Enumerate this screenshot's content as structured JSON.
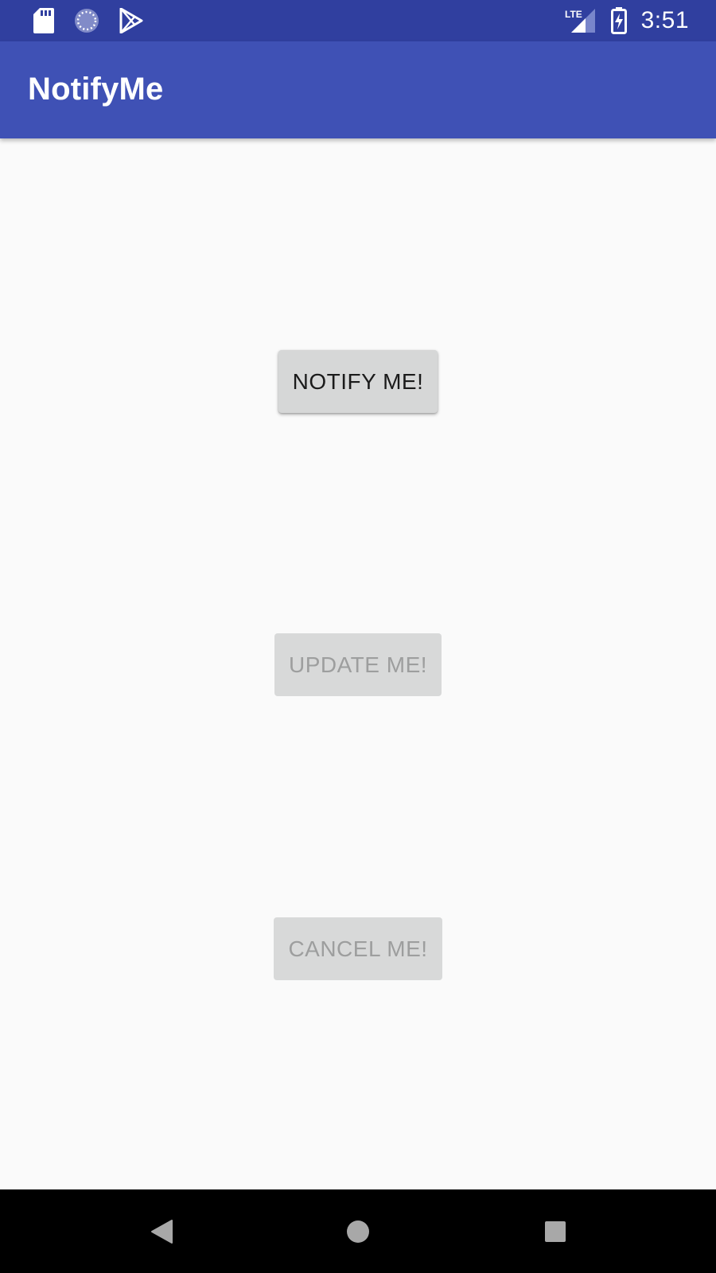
{
  "status_bar": {
    "time": "3:51",
    "network_label": "LTE",
    "left_icons": [
      "sd-card-icon",
      "sync-loading-icon",
      "play-store-icon"
    ],
    "right_icons": [
      "lte-signal-icon",
      "battery-charging-icon"
    ],
    "background_color": "#303f9f"
  },
  "app_bar": {
    "title": "NotifyMe",
    "background_color": "#3f51b5"
  },
  "main": {
    "buttons": [
      {
        "label": "NOTIFY ME!",
        "enabled": true
      },
      {
        "label": "UPDATE ME!",
        "enabled": false
      },
      {
        "label": "CANCEL ME!",
        "enabled": false
      }
    ]
  },
  "nav_bar": {
    "icons": [
      "back-icon",
      "home-icon",
      "recents-icon"
    ]
  }
}
